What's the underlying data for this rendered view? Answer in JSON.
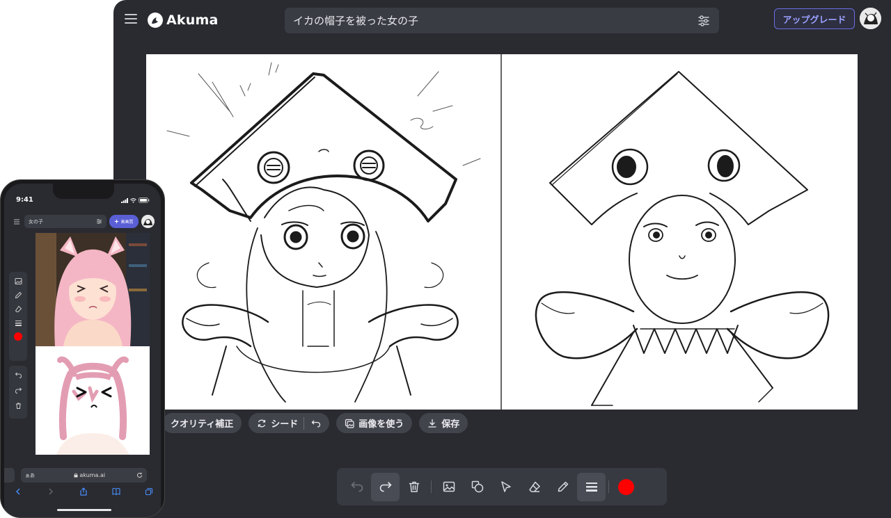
{
  "app": {
    "logo_text": "Akuma",
    "prompt_value": "イカの帽子を被った女の子",
    "upgrade_label": "アップグレード",
    "actions": {
      "quality": "クオリティ補正",
      "seed": "シード",
      "use_image": "画像を使う",
      "save": "保存"
    },
    "toolbar": {
      "tools": [
        "undo-icon",
        "redo-icon",
        "trash-icon",
        "image-icon",
        "shapes-icon",
        "pointer-icon",
        "eraser-icon",
        "pencil-icon",
        "stroke-width-icon",
        "color-swatch"
      ],
      "brush_color": "#ff0000"
    }
  },
  "phone": {
    "time": "9:41",
    "prompt_value": "女の子",
    "hq_label": "高画質",
    "url_aa": "ぁあ",
    "url": "akuma.ai"
  },
  "colors": {
    "app_bg": "#2a2b31",
    "accent": "#6a6fe0",
    "brush": "#ff0000"
  }
}
